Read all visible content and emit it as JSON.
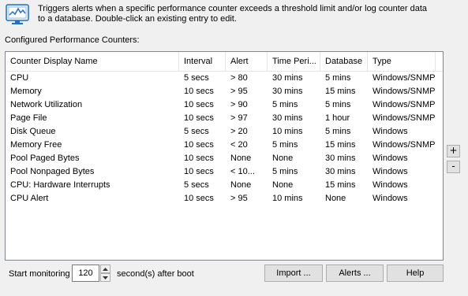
{
  "description": "Triggers alerts when a specific performance counter exceeds a threshold limit and/or log counter data to a database. Double-click an existing entry to edit.",
  "section_label": "Configured Performance Counters:",
  "columns": [
    "Counter Display Name",
    "Interval",
    "Alert",
    "Time Peri...",
    "Database",
    "Type"
  ],
  "rows": [
    [
      "CPU",
      "5 secs",
      "> 80",
      "30 mins",
      "5 mins",
      "Windows/SNMP"
    ],
    [
      "Memory",
      "10 secs",
      "> 95",
      "30 mins",
      "15 mins",
      "Windows/SNMP"
    ],
    [
      "Network Utilization",
      "10 secs",
      "> 90",
      "5 mins",
      "5 mins",
      "Windows/SNMP"
    ],
    [
      "Page File",
      "10 secs",
      "> 97",
      "30 mins",
      "1 hour",
      "Windows/SNMP"
    ],
    [
      "Disk Queue",
      "5 secs",
      "> 20",
      "10 mins",
      "5 mins",
      "Windows"
    ],
    [
      "Memory Free",
      "10 secs",
      "< 20",
      "5 mins",
      "15 mins",
      "Windows/SNMP"
    ],
    [
      "Pool Paged Bytes",
      "10 secs",
      "None",
      "None",
      "30 mins",
      "Windows"
    ],
    [
      "Pool Nonpaged Bytes",
      "10 secs",
      "< 10...",
      "5 mins",
      "30 mins",
      "Windows"
    ],
    [
      "CPU: Hardware Interrupts",
      "5 secs",
      "None",
      "None",
      "15 mins",
      "Windows"
    ],
    [
      "CPU Alert",
      "10 secs",
      "> 95",
      "10 mins",
      "None",
      "Windows"
    ]
  ],
  "side_buttons": {
    "add": "+",
    "remove": "-"
  },
  "footer": {
    "start_label": "Start monitoring",
    "seconds_value": "120",
    "after_label": "second(s) after boot",
    "import_label": "Import ...",
    "alerts_label": "Alerts ...",
    "help_label": "Help"
  },
  "icon": "performance-monitor-icon",
  "colors": {
    "accent": "#1e6fc9",
    "list_border": "#828790"
  }
}
